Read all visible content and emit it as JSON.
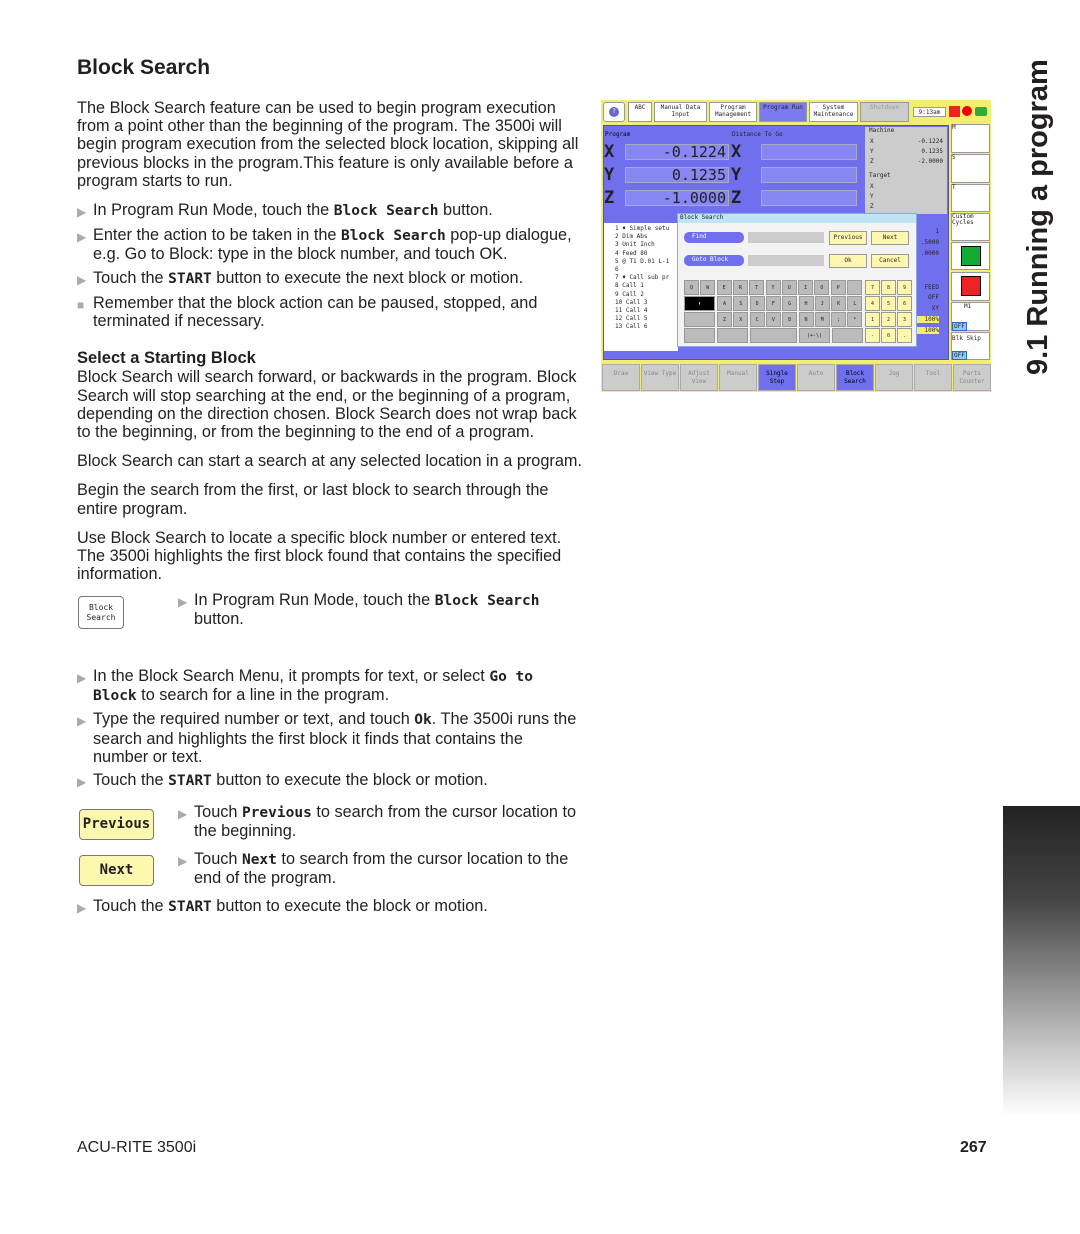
{
  "page": {
    "title": "Block Search",
    "chapter": "9.1 Running a program",
    "footer_left": "ACU-RITE 3500i",
    "page_number": "267"
  },
  "intro": "The Block Search feature can be used to begin program execution from a point other than the beginning of the program.  The 3500i will begin program execution from the selected block location, skipping all previous blocks in the program.This feature is only available before a program starts to run.",
  "steps1": [
    {
      "pre": "In Program Run Mode, touch the ",
      "code": "Block Search",
      "post": " button."
    },
    {
      "pre": "Enter the action to be taken in the ",
      "code": "Block Search",
      "post": " pop-up dialogue, e.g. Go to Block: type in the block number, and touch OK."
    },
    {
      "pre": "Touch the ",
      "code": "START",
      "post": " button to execute the next block or motion."
    }
  ],
  "note": "Remember that the block action can be paused, stopped, and terminated if necessary.",
  "section2": {
    "title": "Select a Starting Block",
    "paras": [
      "Block Search will search forward, or backwards in the program. Block Search will stop searching at the end, or the beginning of a program, depending on the direction chosen.  Block Search does not wrap back to the beginning, or from the beginning to the end of a program.",
      "Block Search can start a search at any selected location in a program.",
      "Begin the search from the first, or last block to search through the entire program.",
      "Use Block Search to locate a specific block number or entered text. The 3500i highlights the first block found that contains the specified information."
    ]
  },
  "block_search_btn": {
    "line1": "Block",
    "line2": "Search"
  },
  "step_bs": {
    "pre": "In Program Run Mode, touch the ",
    "code": "Block Search",
    "post": " button."
  },
  "steps2": [
    {
      "pre": "In the Block Search Menu, it prompts for text, or select ",
      "code": "Go to Block",
      "post": " to search for a line in the program."
    },
    {
      "pre": "Type the required number or text, and touch ",
      "code": "Ok",
      "post": ". The 3500i runs the search and highlights the first block it finds that contains the number or text."
    },
    {
      "pre": "Touch the ",
      "code": "START",
      "post": " button to execute the block or motion."
    }
  ],
  "prev_btn": "Previous",
  "next_btn": "Next",
  "step_prev": {
    "pre": "Touch ",
    "code": "Previous",
    "post": " to search from the cursor location to the beginning."
  },
  "step_next": {
    "pre": "Touch ",
    "code": "Next",
    "post": " to search from the cursor location to the end of the program."
  },
  "step_last": {
    "pre": "Touch the ",
    "code": "START",
    "post": " button to execute the block or motion."
  },
  "screen": {
    "top_tabs": [
      "ABC",
      "Manual Data Input",
      "Program Management",
      "Program Run",
      "System Maintenance",
      "Shutdown"
    ],
    "active_tab": "Program Run",
    "time": "9:13am",
    "program_label": "Program",
    "dtg_label": "Distance To Go",
    "machine_label": "Machine",
    "target_label": "Target",
    "axes": [
      {
        "a": "X",
        "v": "-0.1224",
        "m": "-0.1224"
      },
      {
        "a": "Y",
        "v": "0.1235",
        "m": "0.1235"
      },
      {
        "a": "Z",
        "v": "-1.0000",
        "m": "-2.0000"
      }
    ],
    "program_lines": [
      "1 ♦ Simple setu",
      "2 Dim Abs",
      "3 Unit Inch",
      "4 Feed 80",
      "5 @ T1 D.01 L-1",
      "6",
      "7 ♦ Call sub pr",
      "8 Call 1",
      "9 Call 2",
      "10 Call 3",
      "11 Call 4",
      "12 Call 5",
      "13 Call 6"
    ],
    "dialog": {
      "title": "Block Search",
      "find": "Find",
      "goto": "Goto Block",
      "previous": "Previous",
      "next": "Next",
      "ok": "Ok",
      "cancel": "Cancel"
    },
    "keys_row1": [
      "Q",
      "W",
      "E",
      "R",
      "T",
      "Y",
      "U",
      "I",
      "O",
      "P"
    ],
    "keys_row2": [
      "A",
      "S",
      "D",
      "F",
      "G",
      "H",
      "J",
      "K",
      "L"
    ],
    "keys_row3": [
      "Z",
      "X",
      "C",
      "V",
      "B",
      "N",
      "M",
      ";",
      "*"
    ],
    "key_sign": "(+-\\)",
    "numpad": [
      "7",
      "8",
      "9",
      "4",
      "5",
      "6",
      "1",
      "2",
      "3",
      "-",
      "0",
      "."
    ],
    "right_values": [
      "1",
      ".5000",
      ".0000",
      "FEED",
      "OFF",
      "XY",
      "100%",
      "100%"
    ],
    "side": [
      "M",
      "S",
      "T",
      "Custom Cycles",
      "M1",
      "OFF",
      "Blk Skip",
      "OFF"
    ],
    "softkeys": [
      "Draw",
      "View Type",
      "Adjust View",
      "Manual",
      "Single Step",
      "Auto",
      "Block Search",
      "Jog",
      "Tool",
      "Parts Counter"
    ],
    "active_softkeys": [
      "Single Step",
      "Block Search"
    ],
    "colors": {
      "panel": "#7070ee",
      "frame": "#f4ee70",
      "key_yellow": "#fdf8b0"
    }
  }
}
